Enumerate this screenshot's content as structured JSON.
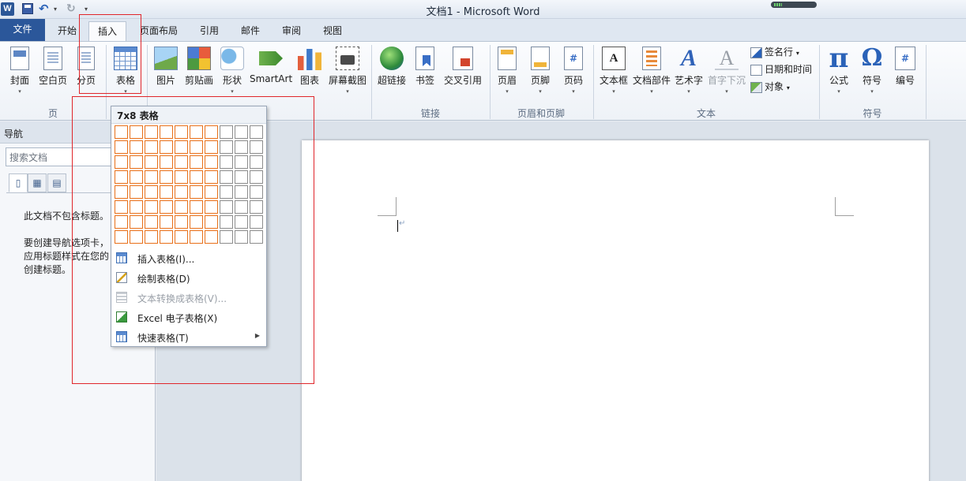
{
  "titlebar": {
    "title": "文档1 - Microsoft Word",
    "app_logo": "W"
  },
  "tabs": {
    "file": "文件",
    "home": "开始",
    "insert": "插入",
    "page_layout": "页面布局",
    "references": "引用",
    "mailings": "邮件",
    "review": "审阅",
    "view": "视图"
  },
  "ribbon": {
    "pages": {
      "cover": "封面",
      "blank": "空白页",
      "break": "分页",
      "group": "页"
    },
    "tables": {
      "table": "表格"
    },
    "illustrations": {
      "picture": "图片",
      "clipart": "剪贴画",
      "shapes": "形状",
      "smartart": "SmartArt",
      "chart": "图表",
      "screenshot": "屏幕截图"
    },
    "links": {
      "hyperlink": "超链接",
      "bookmark": "书签",
      "crossref": "交叉引用",
      "group": "链接"
    },
    "header_footer": {
      "header": "页眉",
      "footer": "页脚",
      "page_number": "页码",
      "group": "页眉和页脚"
    },
    "text": {
      "textbox": "文本框",
      "quickparts": "文档部件",
      "wordart": "艺术字",
      "dropcap": "首字下沉",
      "signature": "签名行",
      "datetime": "日期和时间",
      "object": "对象",
      "group": "文本"
    },
    "symbols": {
      "equation": "公式",
      "symbol": "符号",
      "number": "编号",
      "group": "符号",
      "pi_glyph": "π",
      "omega_glyph": "Ω",
      "hash_glyph": "#"
    },
    "textbox_glyph": "A",
    "wordart_glyph": "A",
    "dropcap_glyph": "A"
  },
  "navigation": {
    "title": "导航",
    "search_placeholder": "搜索文档",
    "message_line1": "此文档不包含标题。",
    "message_line2": "要创建导航选项卡，",
    "message_line3": "应用标题样式在您的",
    "message_line4": "创建标题。"
  },
  "table_dropdown": {
    "header": "7x8 表格",
    "grid": {
      "cols": 10,
      "rows": 8,
      "selected_cols": 7,
      "selected_rows": 8
    },
    "items": [
      {
        "label": "插入表格(I)...",
        "enabled": true
      },
      {
        "label": "绘制表格(D)",
        "enabled": true
      },
      {
        "label": "文本转换成表格(V)...",
        "enabled": false
      },
      {
        "label": "Excel 电子表格(X)",
        "enabled": true
      },
      {
        "label": "快速表格(T)",
        "enabled": true,
        "submenu": true
      }
    ]
  },
  "document": {
    "paragraph_mark": "↵"
  },
  "colors": {
    "file_tab": "#2b579a",
    "grid_selected": "#e8701a",
    "annotation": "#e0262b"
  }
}
